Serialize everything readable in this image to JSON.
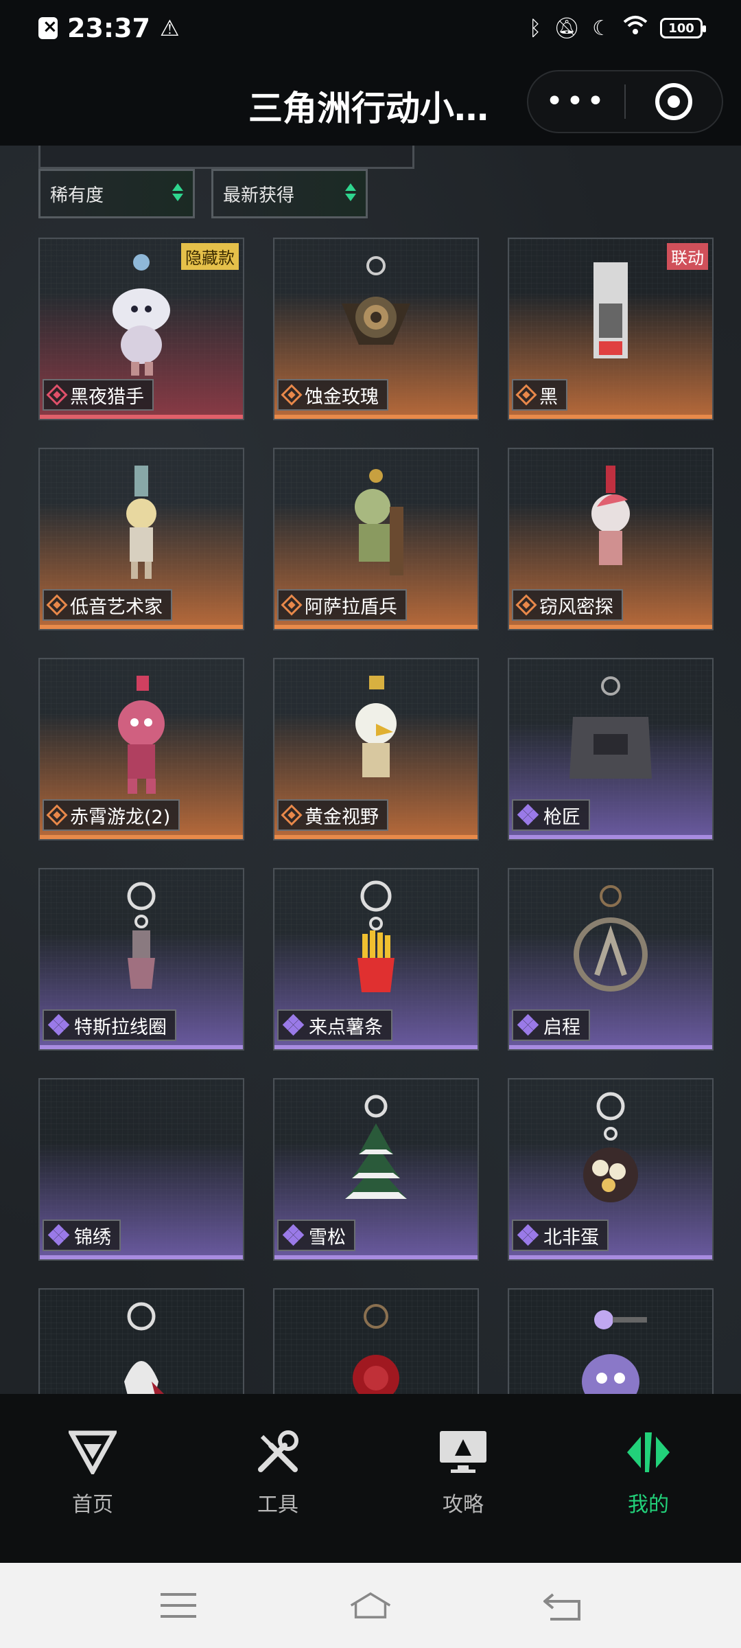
{
  "status": {
    "time": "23:37",
    "battery": "100"
  },
  "header": {
    "title": "三角洲行动小…"
  },
  "filters": {
    "rarity": "稀有度",
    "sort": "最新获得"
  },
  "items": [
    {
      "name": "黑夜猎手",
      "rarity": "red",
      "tag": "隐藏款"
    },
    {
      "name": "蚀金玫瑰",
      "rarity": "orange",
      "tag": ""
    },
    {
      "name": "黑",
      "rarity": "orange",
      "tag": "联动"
    },
    {
      "name": "低音艺术家",
      "rarity": "orange",
      "tag": ""
    },
    {
      "name": "阿萨拉盾兵",
      "rarity": "orange",
      "tag": ""
    },
    {
      "name": "窃风密探",
      "rarity": "orange",
      "tag": ""
    },
    {
      "name": "赤霄游龙(2)",
      "rarity": "orange",
      "tag": ""
    },
    {
      "name": "黄金视野",
      "rarity": "orange",
      "tag": ""
    },
    {
      "name": "枪匠",
      "rarity": "purple",
      "tag": ""
    },
    {
      "name": "特斯拉线圈",
      "rarity": "purple",
      "tag": ""
    },
    {
      "name": "来点薯条",
      "rarity": "purple",
      "tag": ""
    },
    {
      "name": "启程",
      "rarity": "purple",
      "tag": ""
    },
    {
      "name": "锦绣",
      "rarity": "purple",
      "tag": ""
    },
    {
      "name": "雪松",
      "rarity": "purple",
      "tag": ""
    },
    {
      "name": "北非蛋",
      "rarity": "purple",
      "tag": ""
    }
  ],
  "nav": {
    "home": "首页",
    "tools": "工具",
    "guide": "攻略",
    "mine": "我的"
  },
  "colors": {
    "accent": "#22d17a",
    "red": "#e0606a",
    "orange": "#e88a4a",
    "purple": "#a88ce0"
  }
}
